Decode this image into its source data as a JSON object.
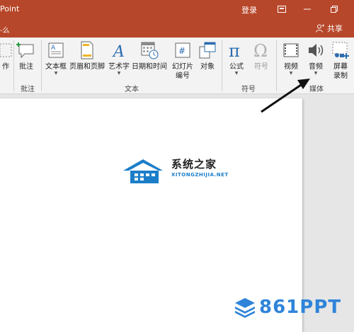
{
  "titlebar": {
    "app_title": "Point",
    "login": "登录",
    "bg_color": "#b7472a"
  },
  "tabrow": {
    "tab_fragment": "-么",
    "share": "共享"
  },
  "ribbon": {
    "items": [
      {
        "label": "作",
        "icon": "partial-icon"
      },
      {
        "label": "批注",
        "icon": "comment-icon"
      },
      {
        "label": "文本框",
        "icon": "textbox-icon"
      },
      {
        "label": "页眉和页脚",
        "icon": "header-footer-icon"
      },
      {
        "label": "艺术字",
        "icon": "wordart-icon"
      },
      {
        "label": "日期和时间",
        "icon": "datetime-icon"
      },
      {
        "label": "幻灯片\n编号",
        "icon": "slide-number-icon"
      },
      {
        "label": "对象",
        "icon": "object-icon"
      },
      {
        "label": "公式",
        "icon": "equation-icon"
      },
      {
        "label": "符号",
        "icon": "symbol-icon"
      },
      {
        "label": "视频",
        "icon": "video-icon"
      },
      {
        "label": "音频",
        "icon": "audio-icon"
      },
      {
        "label": "屏幕\n录制",
        "icon": "screen-recording-icon"
      }
    ],
    "groups": {
      "comments": "批注",
      "text": "文本",
      "symbols": "符号",
      "media": "媒体"
    }
  },
  "watermarks": {
    "logo_cn": "系统之家",
    "logo_en": "XITONGZHIJIA.NET",
    "brand": "861PPT",
    "accent": "#1c7ec9"
  }
}
